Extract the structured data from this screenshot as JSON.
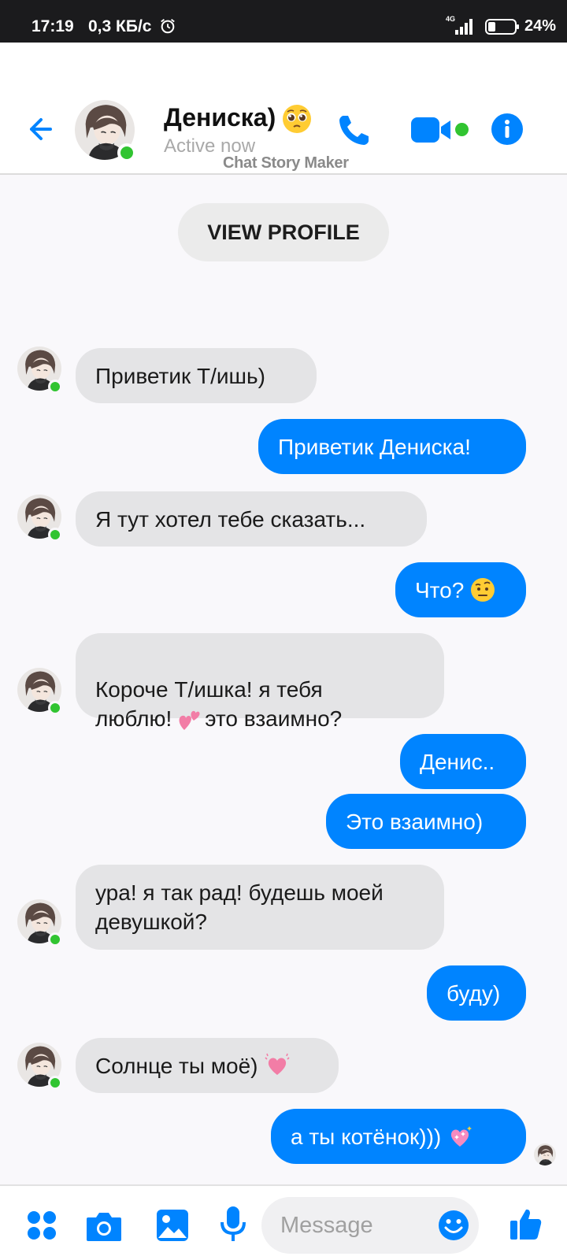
{
  "status_bar": {
    "time": "17:19",
    "speed": "0,3 КБ/с",
    "network": "4G",
    "battery": "24%"
  },
  "header": {
    "contact_name": "Дениска)",
    "name_emoji": "pleading-face",
    "status": "Active now",
    "watermark": "Chat Story Maker",
    "icons": [
      "back-arrow-icon",
      "phone-icon",
      "video-camera-icon",
      "info-icon"
    ],
    "accent_color": "#0084ff",
    "online_color": "#31c431"
  },
  "view_profile_label": "VIEW PROFILE",
  "messages": [
    {
      "side": "in",
      "text": "Приветик Т/ишь)"
    },
    {
      "side": "out",
      "text": "Приветик Дениска!"
    },
    {
      "side": "in",
      "text": "Я тут хотел  тебе сказать..."
    },
    {
      "side": "out",
      "text": "Что?",
      "emoji": "face-with-raised-eyebrow"
    },
    {
      "side": "in",
      "text_a": "Короче Т/ишка! я  тебя\nлюблю!",
      "emoji": "two-hearts",
      "text_b": "это взаимно?"
    },
    {
      "side": "out",
      "text": "Денис.."
    },
    {
      "side": "out",
      "text": "Это взаимно)"
    },
    {
      "side": "in",
      "text": "ура! я так рад! будешь моей\nдевушкой?"
    },
    {
      "side": "out",
      "text": "буду)"
    },
    {
      "side": "in",
      "text": "Солнце ты моё)",
      "emoji": "growing-heart"
    },
    {
      "side": "out",
      "text": "а ты котёнок)))",
      "emoji": "sparkling-heart"
    }
  ],
  "bottom_bar": {
    "input_placeholder": "Message",
    "icons": [
      "menu-dots-icon",
      "camera-icon",
      "gallery-icon",
      "microphone-icon",
      "smile-icon",
      "thumbs-up-icon"
    ]
  }
}
